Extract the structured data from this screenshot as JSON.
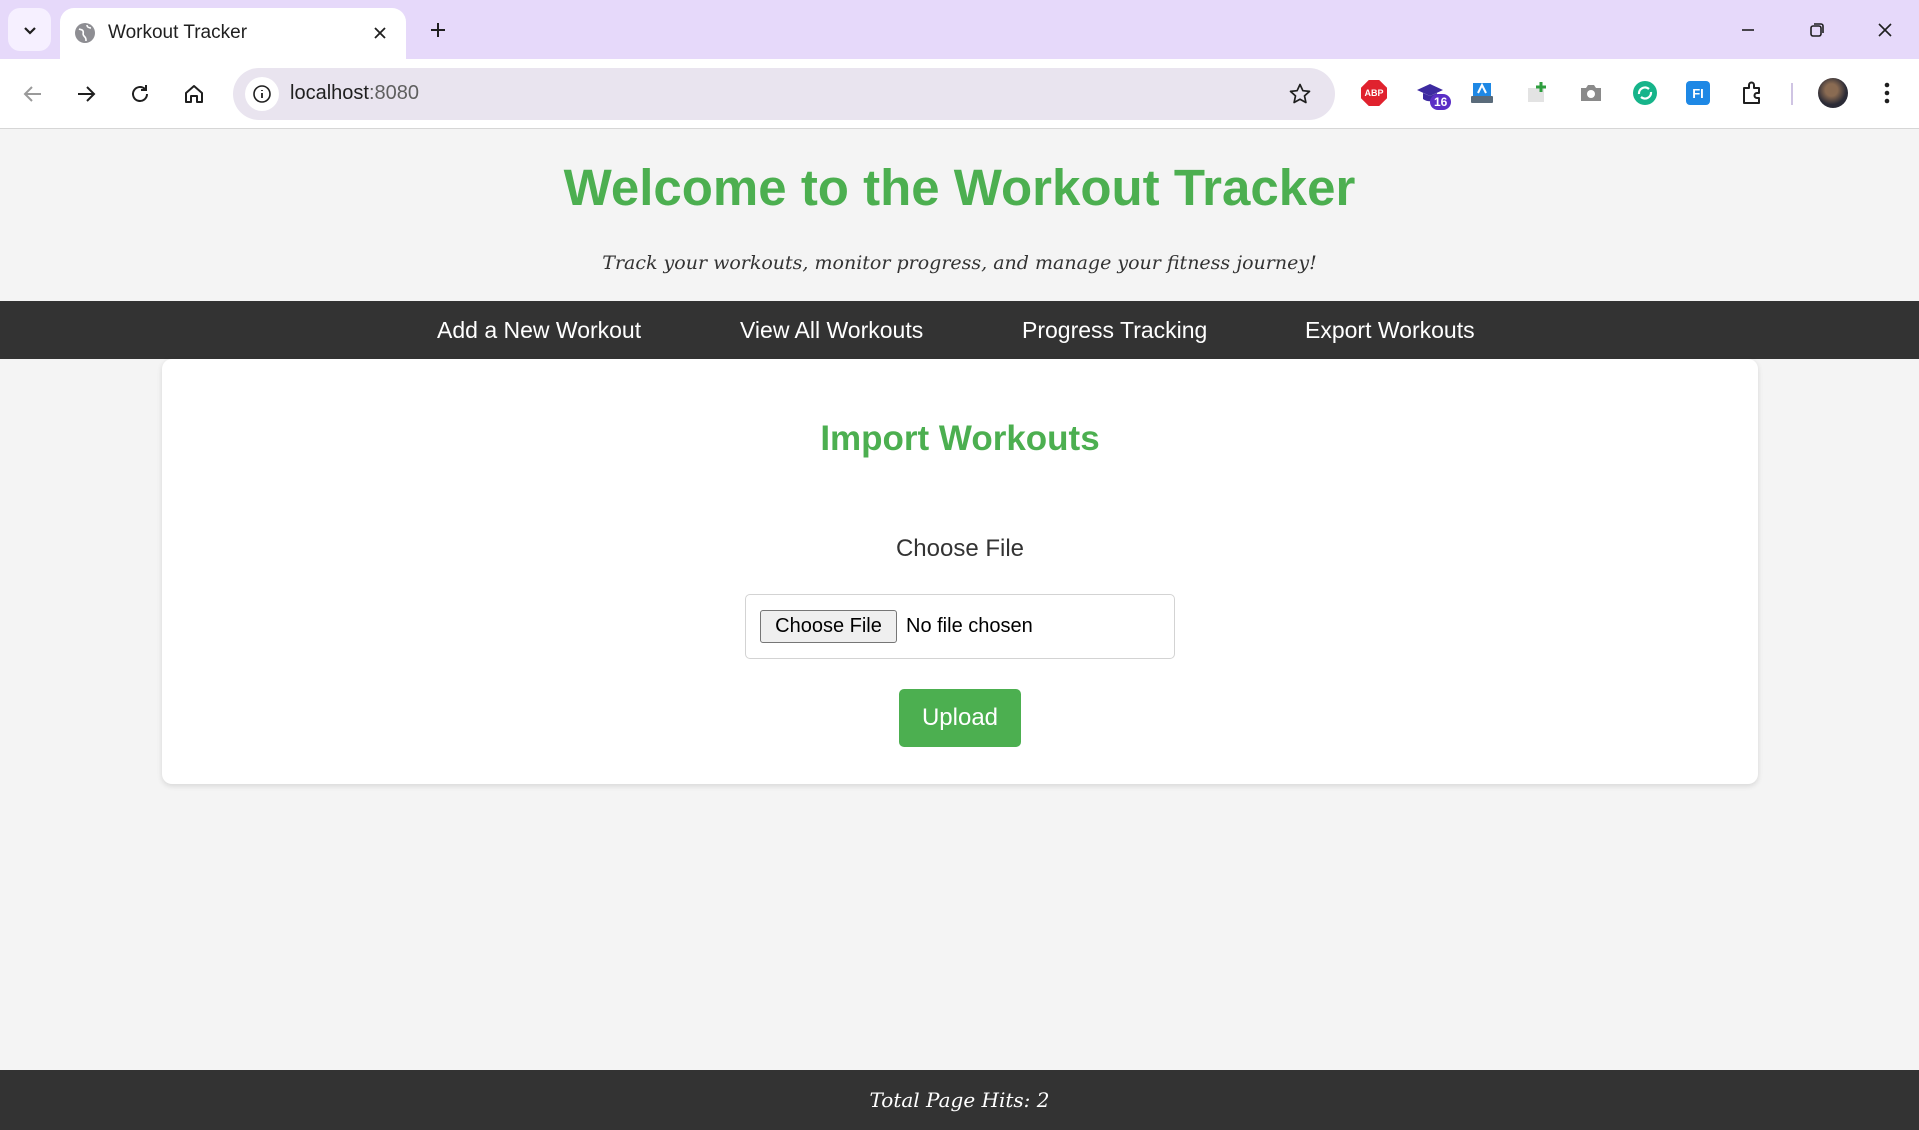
{
  "browser": {
    "tab_title": "Workout Tracker",
    "url_host": "localhost",
    "url_port": ":8080",
    "extension_badge": "16",
    "abp_label": "ABP",
    "fi_label": "FI"
  },
  "page": {
    "title": "Welcome to the Workout Tracker",
    "subtitle": "Track your workouts, monitor progress, and manage your fitness journey!",
    "accent_color": "#4caf50",
    "nav_bg_color": "#333333"
  },
  "nav": {
    "items": [
      {
        "label": "Add a New Workout"
      },
      {
        "label": "View All Workouts"
      },
      {
        "label": "Progress Tracking"
      },
      {
        "label": "Export Workouts"
      }
    ]
  },
  "import": {
    "title": "Import Workouts",
    "file_label": "Choose File",
    "file_button": "Choose File",
    "file_status": "No file chosen",
    "upload_button": "Upload"
  },
  "footer": {
    "text": "Total Page Hits: 2"
  }
}
